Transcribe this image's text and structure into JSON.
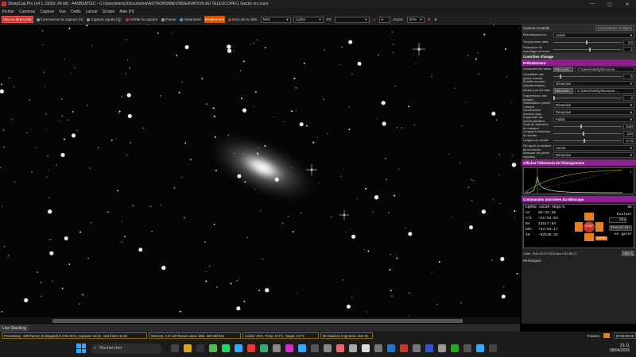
{
  "window": {
    "title": "SharpCap Pro (v4.1.13000, 64 bit) - AA5BSMTEC - C:\\Users\\micky\\Documents\\ASTRONOMIE\\OBSERVATION AU TELESCOPE\\1 Stacks en cours",
    "controls": [
      "—",
      "▢",
      "✕"
    ]
  },
  "menu": [
    "Fichier",
    "Caméras",
    "Capture",
    "Vue",
    "Outils",
    "Lancer",
    "Scripts",
    "Aide (H)"
  ],
  "toolbar": {
    "live": "Vue en direct (W)",
    "start": "Commencer la capture (S)",
    "quick": "Capture rapide (Q)",
    "stop": "Arrêter la capture",
    "pause": "Pause",
    "snapshot": "Instantané",
    "stacking": "Empilement",
    "target_label": "Nom de la cible",
    "target_value": "M63",
    "frame_type": "Lights",
    "fx_label": "FX",
    "zoom_label": "Zoom:",
    "zoom_value": "50%"
  },
  "live_tab": "Live Stacking",
  "panel": {
    "header": "Camera Controls",
    "header_button": "Commandes multiples",
    "rows_top": [
      {
        "label": "Refroidissement",
        "value": "Activé",
        "type": "select"
      },
      {
        "label": "Température cible",
        "value": "0.0",
        "type": "slider",
        "pos": 0.5
      },
      {
        "label": "Puissance de chauffage de buée",
        "value": "2",
        "type": "slider",
        "pos": 0.55
      }
    ],
    "image_controls": "Contrôles d'image",
    "pretraitement": "Prétraitement",
    "rows_pre": [
      {
        "label": "Soustraire les darks",
        "value": "C:\\Users\\micky\\Docume...",
        "type": "browse",
        "browse": "Parcourir..."
      },
      {
        "label": "Sensibilité des pixels chauds",
        "value": "5",
        "type": "slider",
        "pos": 0.1
      },
      {
        "label": "Echelle sombre (expérimentale)",
        "value": "Désactivé",
        "type": "select"
      },
      {
        "label": "Diviser par les flats",
        "value": "C:\\Users\\micky\\Docume...",
        "type": "browse",
        "browse": "Parcourir..."
      },
      {
        "label": "Suppression des bandes",
        "value": "0",
        "type": "slider",
        "pos": 0.0
      },
      {
        "label": "Stabilisation planéit / disque",
        "value": "Désactivé",
        "type": "select"
      },
      {
        "label": "Soustraction d'ombre plan",
        "value": "Désactivé",
        "type": "select"
      },
      {
        "label": "Supprimer les traces satellites",
        "value": "Faible",
        "type": "select"
      },
      {
        "label": "Seuil de détection du masque",
        "value": "8.60",
        "type": "slider",
        "pos": 0.42
      },
      {
        "label": "Longueur minimale du sentier",
        "value": "234",
        "type": "slider",
        "pos": 0.45
      },
      {
        "label": "Largeur du sentier",
        "value": "4.73",
        "type": "slider",
        "pos": 0.47
      },
      {
        "label": "Pic après le tombée de la courbe",
        "value": "Aucun",
        "type": "select"
      },
      {
        "label": "Masquer les pixels exposés",
        "value": "Désactivé",
        "type": "select"
      }
    ],
    "histogram_header": "Afficher l'étirement de l'histogramme",
    "mount_header": "Commandes motrisées du télescope",
    "mount_name": "EQMOD ASCOM HEQ5/6",
    "mount_ok": "OK",
    "mount_coords": [
      {
        "k": "Az",
        "v": "85°31:36"
      },
      {
        "k": "Alt",
        "v": "+41°54:03"
      },
      {
        "k": "RA",
        "v": "13h17:04"
      },
      {
        "k": "Déc",
        "v": "+41°53:17"
      },
      {
        "k": "AH",
        "v": "-02h35:35"
      }
    ],
    "mount_speed_label": "Évaluer",
    "mount_speed": "32x",
    "mount_install": "Installer",
    "mount_park": "en garer",
    "mount_stop": "STOP",
    "mount_sync": "Sync",
    "target_line": "Cible : RA=13:17:02.5,Dec=+41:53:17",
    "goto_button": "Aller à",
    "remarks": "Remarques"
  },
  "status": {
    "processing": "Processing : 208 frames (8 dropped) in 0:51:50.5, exposure 10.0s , last frame 10.0s",
    "memory": "Memory: 4 of 129 frames used, Disk: 339 GB free",
    "cooler": "Cooler: 24%, Temp: 0.0°C, Target: 0.0°C",
    "stacked": "90 Stacked, 0 Ignored, 15m 0s",
    "frames_label": "Frames",
    "elapsed": "00:02:00:08"
  },
  "taskbar": {
    "search_placeholder": "Rechercher",
    "time": "23:11",
    "date": "08/04/2026"
  }
}
